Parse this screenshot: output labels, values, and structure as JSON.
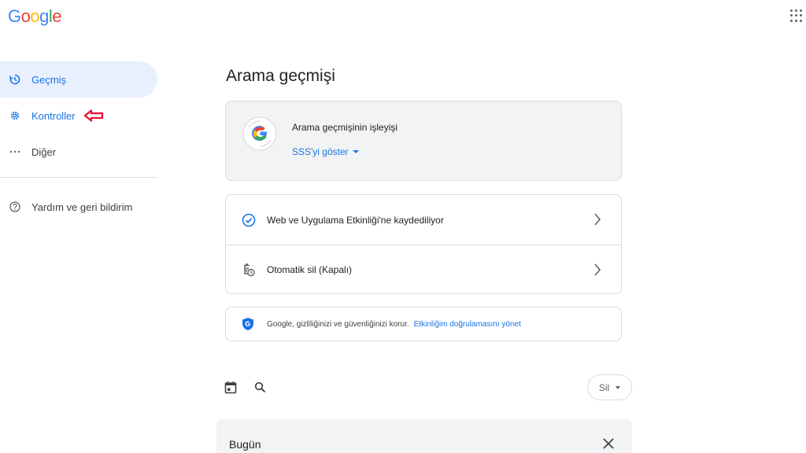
{
  "header": {
    "logo": [
      "G",
      "o",
      "o",
      "g",
      "l",
      "e"
    ],
    "logo_colors": [
      "#4285F4",
      "#EA4335",
      "#FBBC05",
      "#4285F4",
      "#34A853",
      "#EA4335"
    ],
    "apps_icon": "apps-grid-icon"
  },
  "sidebar": {
    "items": [
      {
        "label": "Geçmiş",
        "icon": "history-icon",
        "active": true
      },
      {
        "label": "Kontroller",
        "icon": "gear-icon",
        "active": false
      },
      {
        "label": "Diğer",
        "icon": "more-horiz-icon",
        "active": false
      }
    ],
    "help": {
      "label": "Yardım ve geri bildirim",
      "icon": "help-icon"
    }
  },
  "main": {
    "title": "Arama geçmişi",
    "info_card": {
      "title": "Arama geçmişinin işleyişi",
      "link": "SSS'yi göster"
    },
    "settings": [
      {
        "label": "Web ve Uygulama Etkinliği'ne kaydediliyor",
        "icon": "check-circle-icon"
      },
      {
        "label": "Otomatik sil (Kapalı)",
        "icon": "auto-delete-icon"
      }
    ],
    "privacy": {
      "text": "Google, gizliliğinizi ve güvenliğinizi korur.",
      "link": "Etkinliğim doğrulamasını yönet"
    },
    "toolbar": {
      "delete_label": "Sil"
    },
    "today": {
      "label": "Bugün"
    }
  },
  "colors": {
    "accent": "#1a73e8",
    "active_bg": "#e8f0fe",
    "annotation_arrow": "#e8112d"
  }
}
